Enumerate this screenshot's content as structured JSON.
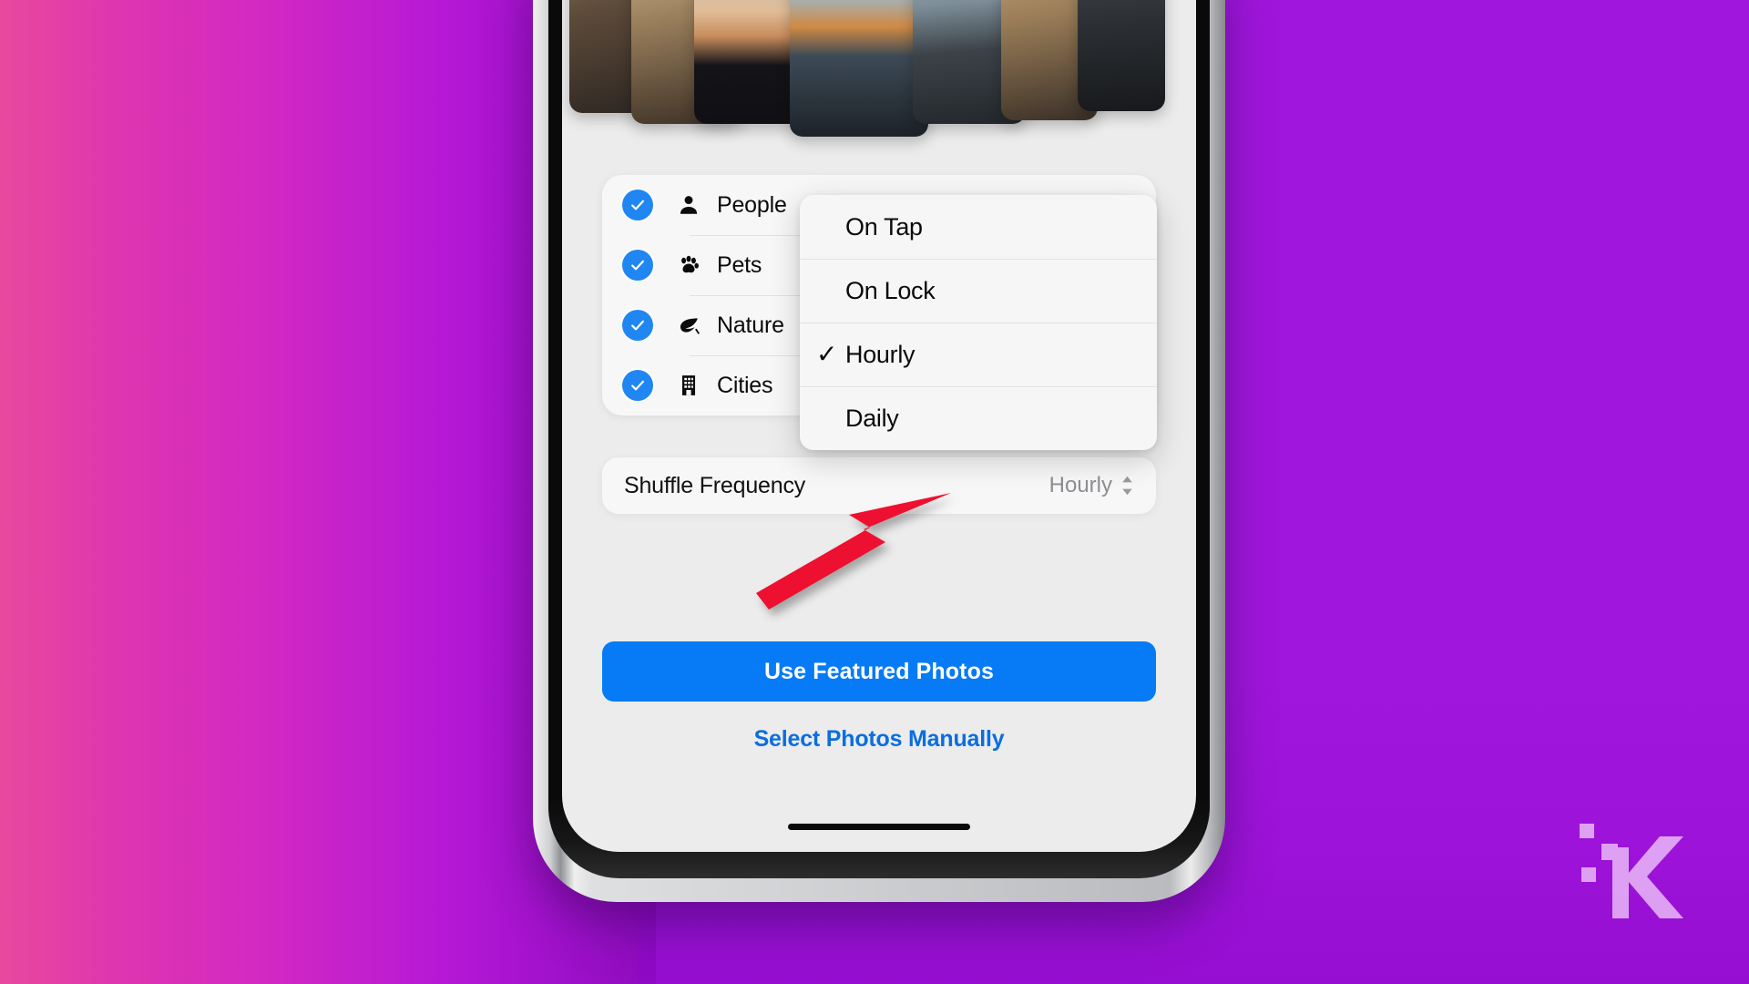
{
  "background": {
    "left_gradient_from": "#E8499E",
    "left_gradient_to": "#8E0BBE",
    "right_color": "#A016DC"
  },
  "watermark": {
    "name": "knowtechie-k-logo",
    "letter": "K"
  },
  "phone": {
    "screen_bg": "#ECECEC",
    "photo_strip": {
      "name": "featured-photos-strip",
      "photos": [
        {
          "alt": "person-in-cap",
          "tone1": "#7d6a54",
          "tone2": "#3a2f26"
        },
        {
          "alt": "cat-and-plant",
          "tone1": "#c9a87e",
          "tone2": "#46362a"
        },
        {
          "alt": "sunset-sky",
          "tone1": "#d7b393",
          "tone2": "#1b1b1f"
        },
        {
          "alt": "city-skyline-sunset",
          "tone1": "#8fb6cf",
          "tone2": "#2a3541"
        },
        {
          "alt": "man-portrait",
          "tone1": "#9fb7c9",
          "tone2": "#2b3136"
        },
        {
          "alt": "tabby-cat",
          "tone1": "#c6a87c",
          "tone2": "#3d3127"
        }
      ]
    },
    "categories": {
      "name": "featured-photo-categories",
      "rows": [
        {
          "icon": "person-icon",
          "label": "People",
          "checked": true
        },
        {
          "icon": "paw-icon",
          "label": "Pets",
          "checked": true
        },
        {
          "icon": "leaf-icon",
          "label": "Nature",
          "checked": true
        },
        {
          "icon": "building-icon",
          "label": "Cities",
          "checked": true
        }
      ]
    },
    "shuffle_row": {
      "name": "shuffle-frequency-row",
      "label": "Shuffle Frequency",
      "value": "Hourly"
    },
    "dropdown": {
      "name": "shuffle-frequency-menu",
      "items": [
        {
          "label": "On Tap",
          "selected": false
        },
        {
          "label": "On Lock",
          "selected": false
        },
        {
          "label": "Hourly",
          "selected": true
        },
        {
          "label": "Daily",
          "selected": false
        }
      ],
      "check_glyph": "✓"
    },
    "cta": {
      "label": "Use Featured Photos",
      "color": "#067BF5"
    },
    "secondary": {
      "label": "Select Photos Manually",
      "color": "#0A6EE0"
    }
  },
  "annotation": {
    "name": "red-arrow-callout",
    "color": "#EE1030"
  }
}
